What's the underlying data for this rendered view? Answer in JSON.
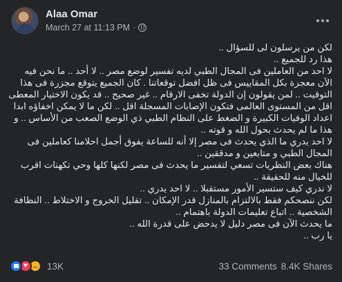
{
  "post": {
    "author": "Alaa Omar",
    "timestamp": "March 27 at 11:13 PM",
    "separator": "·",
    "more_icon": "more-horizontal-icon",
    "privacy_icon": "globe-icon",
    "lines": [
      "لكن من يرسلون لى للسؤال ..",
      "هذا رد للجميع ..",
      "لا احد من العاملين فى المجال الطبي لديه تفسير لوضع مصر .. لا أحد .. ما نحن فيه الآن معجزة بكل المقاييس فى ظل افضل توقعاتنا . كان الجميع يتوقع مجزرة فى هذا التوقيت .. لمن يقولون إن الدولة تخفى الارقام .. غير صحيح .. قد يكون الاختيار المعطى اقل من المستوى العالمى فتكون الإصابات المسجلة اقل .. لكن ما لا يمكن اخفاؤه ابدا اعداد الوفيات الكبيرة و الضغط على النظام الطبي ذي الوضع الصعب من الأساس .. و هذا ما لم يحدث بحول الله و قوته ..",
      "لا احد يدري ما الذي يحدث فى مصر إلا أنه للساعة يفوق أجمل احلامنا كعاملين فى المجال الطبي و متابعين و مدققين ..",
      "هناك بعض النظريات تسعي لتفسير ما يحدث فى مصر لكنها كلها وحي تكهنات اقرب للخيال منه للحقيقة ..",
      "لا ندري كيف ستسير الأمور مستقبلا .. لا احد يدري ..",
      "لكن ننصحكم فقط بالالتزام بالمنازل قدر الإمكان .. تقليل الخروج و الاختلاط .. النظافة الشخصية .. اتباع تعليمات الدولة باهتمام ..",
      "ما يحدث الآن فى مصر دليل لا يدحض على قدرة الله ..",
      "يا رب .."
    ],
    "reactions": {
      "icons": [
        "like-reaction-icon",
        "love-reaction-icon",
        "sad-reaction-icon"
      ],
      "count": "13K"
    },
    "comments": "33 Comments",
    "shares": "8.4K Shares"
  }
}
